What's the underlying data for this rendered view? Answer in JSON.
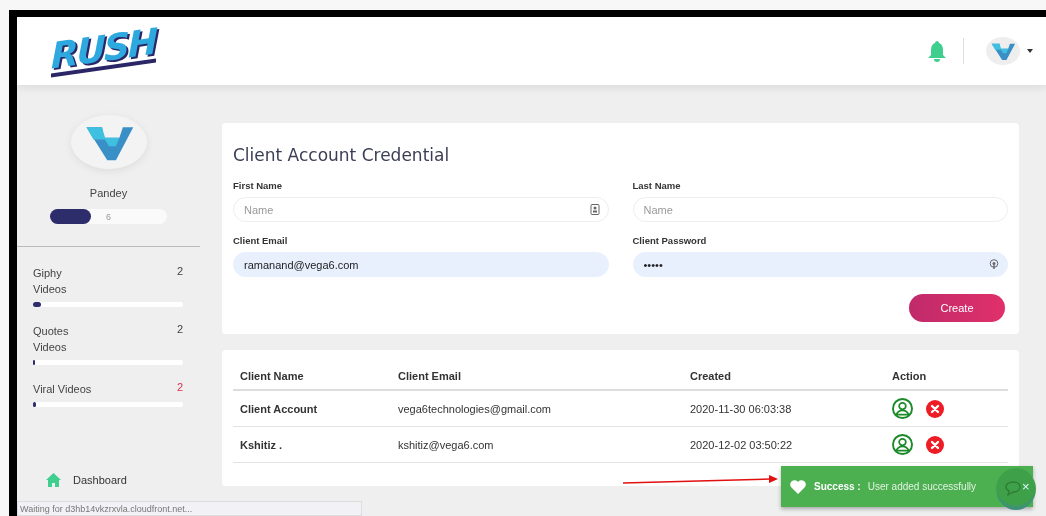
{
  "header": {
    "logo": "RUSH"
  },
  "profile": {
    "name": "Pandey",
    "level": 0.35,
    "count": "6"
  },
  "stats": [
    {
      "label": "Giphy Videos",
      "count": "2",
      "level": 0.05,
      "alert": false
    },
    {
      "label": "Quotes Videos",
      "count": "2",
      "level": 0.01,
      "alert": false
    },
    {
      "label": "Viral Videos",
      "count": "2",
      "level": 0.02,
      "alert": true
    }
  ],
  "nav": [
    {
      "label": "Dashboard"
    }
  ],
  "form": {
    "title": "Client Account Credential",
    "fields": [
      {
        "label": "First Name",
        "placeholder": "Name",
        "filled": false,
        "kind": "contact"
      },
      {
        "label": "Last Name",
        "placeholder": "Name",
        "filled": false,
        "kind": "plain"
      },
      {
        "label": "Client Email",
        "value": "ramanand@vega6.com",
        "filled": true,
        "kind": "plain"
      },
      {
        "label": "Client Password",
        "value": "•••••",
        "filled": true,
        "kind": "key"
      }
    ],
    "button": "Create"
  },
  "table": {
    "columns": [
      "Client Name",
      "Client Email",
      "Created",
      "Action"
    ],
    "rows": [
      {
        "name": "Client Account",
        "email": "vega6technologies@gmail.com",
        "created": "2020-11-30 06:03:38"
      },
      {
        "name": "Kshitiz .",
        "email": "kshitiz@vega6.com",
        "created": "2020-12-02 03:50:22"
      }
    ]
  },
  "toast": {
    "title": "Success :",
    "message": "User added successfully",
    "close": "×"
  },
  "status_bar": "Waiting for d3hb14vkzrxvla.cloudfront.net..."
}
